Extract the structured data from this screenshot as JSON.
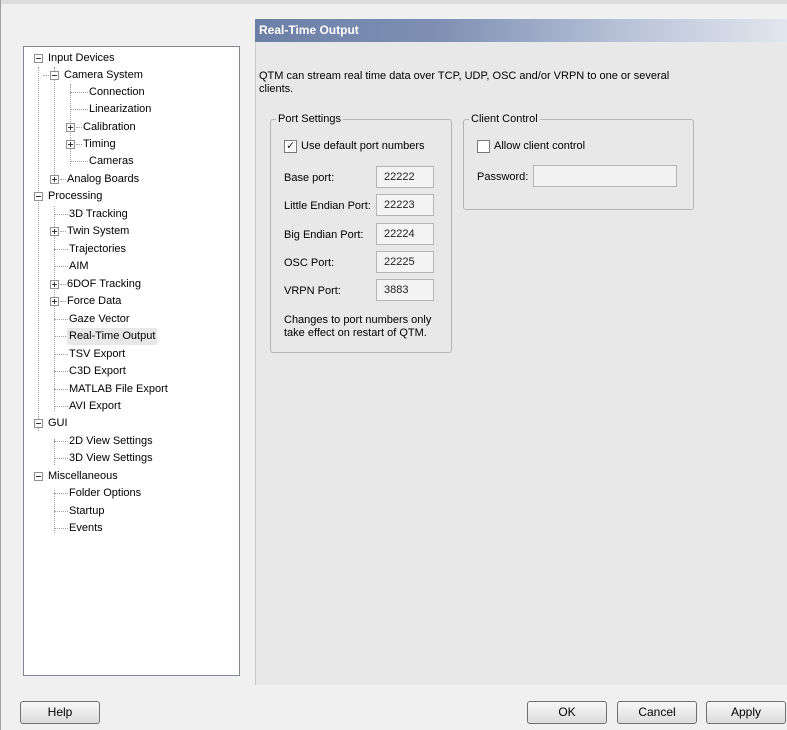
{
  "panel": {
    "title": "Real-Time Output",
    "description": "QTM can stream real time data over TCP, UDP, OSC and/or VRPN to one or several clients."
  },
  "port_settings": {
    "legend": "Port Settings",
    "use_default_label": "Use default port numbers",
    "use_default_checked": true,
    "fields": [
      {
        "label": "Base port:",
        "value": "22222"
      },
      {
        "label": "Little Endian Port:",
        "value": "22223"
      },
      {
        "label": "Big Endian Port:",
        "value": "22224"
      },
      {
        "label": "OSC Port:",
        "value": "22225"
      },
      {
        "label": "VRPN Port:",
        "value": "3883"
      }
    ],
    "note": "Changes to port numbers only take effect on restart of QTM."
  },
  "client_control": {
    "legend": "Client Control",
    "allow_label": "Allow client control",
    "allow_checked": false,
    "password_label": "Password:",
    "password_value": ""
  },
  "tree": {
    "items": [
      {
        "label": "Input Devices",
        "expander": "minus"
      },
      {
        "label": "Camera System",
        "expander": "minus"
      },
      {
        "label": "Connection",
        "expander": null
      },
      {
        "label": "Linearization",
        "expander": null
      },
      {
        "label": "Calibration",
        "expander": "plus"
      },
      {
        "label": "Timing",
        "expander": "plus"
      },
      {
        "label": "Cameras",
        "expander": null
      },
      {
        "label": "Analog Boards",
        "expander": "plus"
      },
      {
        "label": "Processing",
        "expander": "minus"
      },
      {
        "label": "3D Tracking",
        "expander": null
      },
      {
        "label": "Twin System",
        "expander": "plus"
      },
      {
        "label": "Trajectories",
        "expander": null
      },
      {
        "label": "AIM",
        "expander": null
      },
      {
        "label": "6DOF Tracking",
        "expander": "plus"
      },
      {
        "label": "Force Data",
        "expander": "plus"
      },
      {
        "label": "Gaze Vector",
        "expander": null
      },
      {
        "label": "Real-Time Output",
        "expander": null,
        "selected": true
      },
      {
        "label": "TSV Export",
        "expander": null
      },
      {
        "label": "C3D Export",
        "expander": null
      },
      {
        "label": "MATLAB File Export",
        "expander": null
      },
      {
        "label": "AVI Export",
        "expander": null
      },
      {
        "label": "GUI",
        "expander": "minus"
      },
      {
        "label": "2D View Settings",
        "expander": null
      },
      {
        "label": "3D View Settings",
        "expander": null
      },
      {
        "label": "Miscellaneous",
        "expander": "minus"
      },
      {
        "label": "Folder Options",
        "expander": null
      },
      {
        "label": "Startup",
        "expander": null
      },
      {
        "label": "Events",
        "expander": null
      }
    ]
  },
  "buttons": {
    "help": "Help",
    "ok": "OK",
    "cancel": "Cancel",
    "apply": "Apply"
  }
}
